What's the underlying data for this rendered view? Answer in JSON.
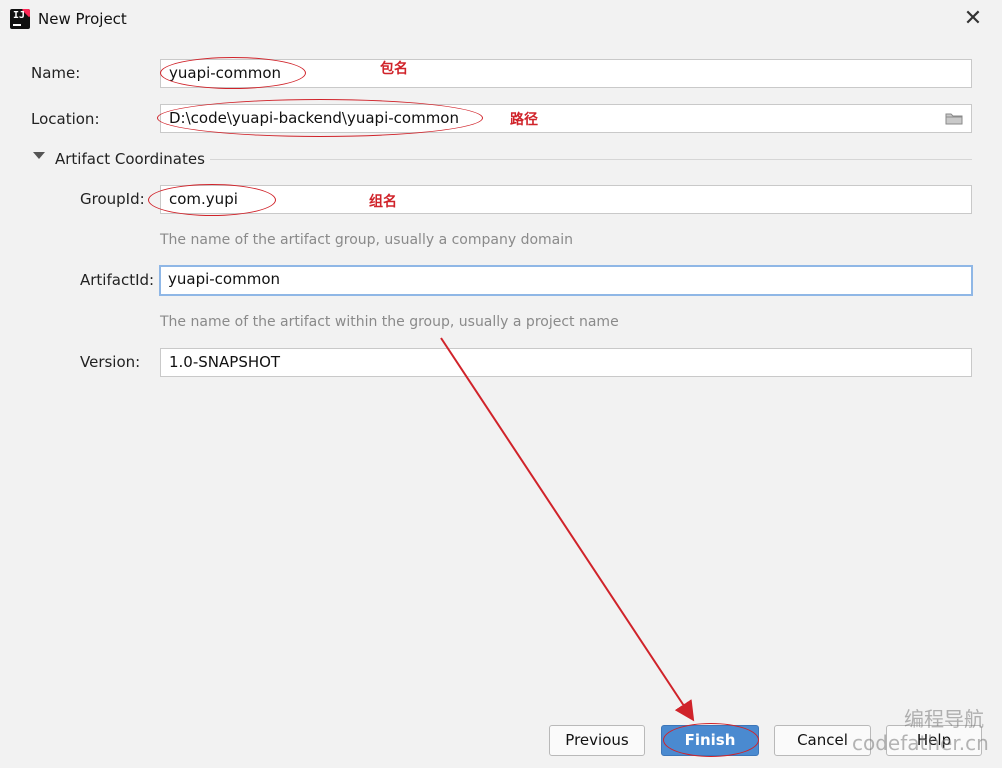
{
  "window": {
    "title": "New Project",
    "app_icon_text": "IJ",
    "close_glyph": "✕"
  },
  "form": {
    "name": {
      "label": "Name:",
      "value": "yuapi-common"
    },
    "location": {
      "label": "Location:",
      "value": "D:\\code\\yuapi-backend\\yuapi-common"
    },
    "artifact_section": {
      "title": "Artifact Coordinates",
      "expanded": true
    },
    "group_id": {
      "label": "GroupId:",
      "value": "com.yupi",
      "hint": "The name of the artifact group, usually a company domain"
    },
    "artifact_id": {
      "label": "ArtifactId:",
      "value": "yuapi-common",
      "hint": "The name of the artifact within the group, usually a project name"
    },
    "version": {
      "label": "Version:",
      "value": "1.0-SNAPSHOT"
    }
  },
  "annotations": {
    "name_note": "包名",
    "location_note": "路径",
    "group_note": "组名"
  },
  "buttons": {
    "previous": "Previous",
    "finish": "Finish",
    "cancel": "Cancel",
    "help": "Help"
  },
  "watermark": {
    "line1": "编程导航",
    "line2": "codefather.cn"
  },
  "colors": {
    "accent": "#4a8ad0",
    "annotation": "#d0232a",
    "focus_border": "#8fb7e6"
  },
  "icons": [
    "intellij-app-icon",
    "close-icon",
    "folder-icon",
    "chevron-down-icon"
  ]
}
